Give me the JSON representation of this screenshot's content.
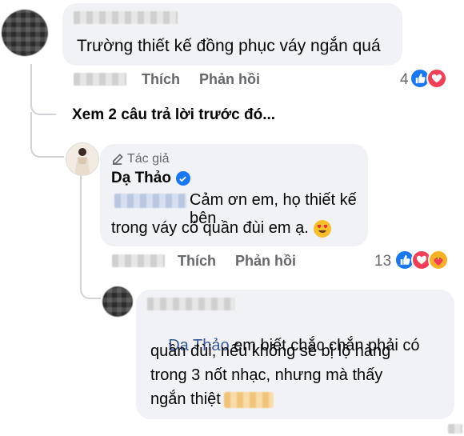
{
  "comment1": {
    "text": "Trường thiết kế đồng phục váy ngắn quá",
    "actions": {
      "like": "Thích",
      "reply": "Phản hồi"
    },
    "reaction_count": "4"
  },
  "view_previous": "Xem 2 câu trả lời trước đó...",
  "reply1": {
    "author_badge": "Tác giả",
    "author_name": "Dạ Thảo",
    "text_line1": "Cảm ơn em, họ thiết kế bên",
    "text_line2": "trong váy có quần đùi em ạ.",
    "emoji": "😍",
    "actions": {
      "like": "Thích",
      "reply": "Phản hồi"
    },
    "reaction_count": "13"
  },
  "reply2": {
    "mention": "Dạ Thảo",
    "text_line1": " em biết chắc chắn phải có",
    "text_line2": "quần đùi, nếu không sẽ bị lộ hàng",
    "text_line3": "trong 3 nốt nhạc, nhưng mà thấy",
    "text_line4": "ngắn thiệt"
  },
  "colors": {
    "like_blue": "#1877f2",
    "love_red": "#f33e58",
    "care_yellow": "#f7b125",
    "mention_blue": "#385898"
  }
}
